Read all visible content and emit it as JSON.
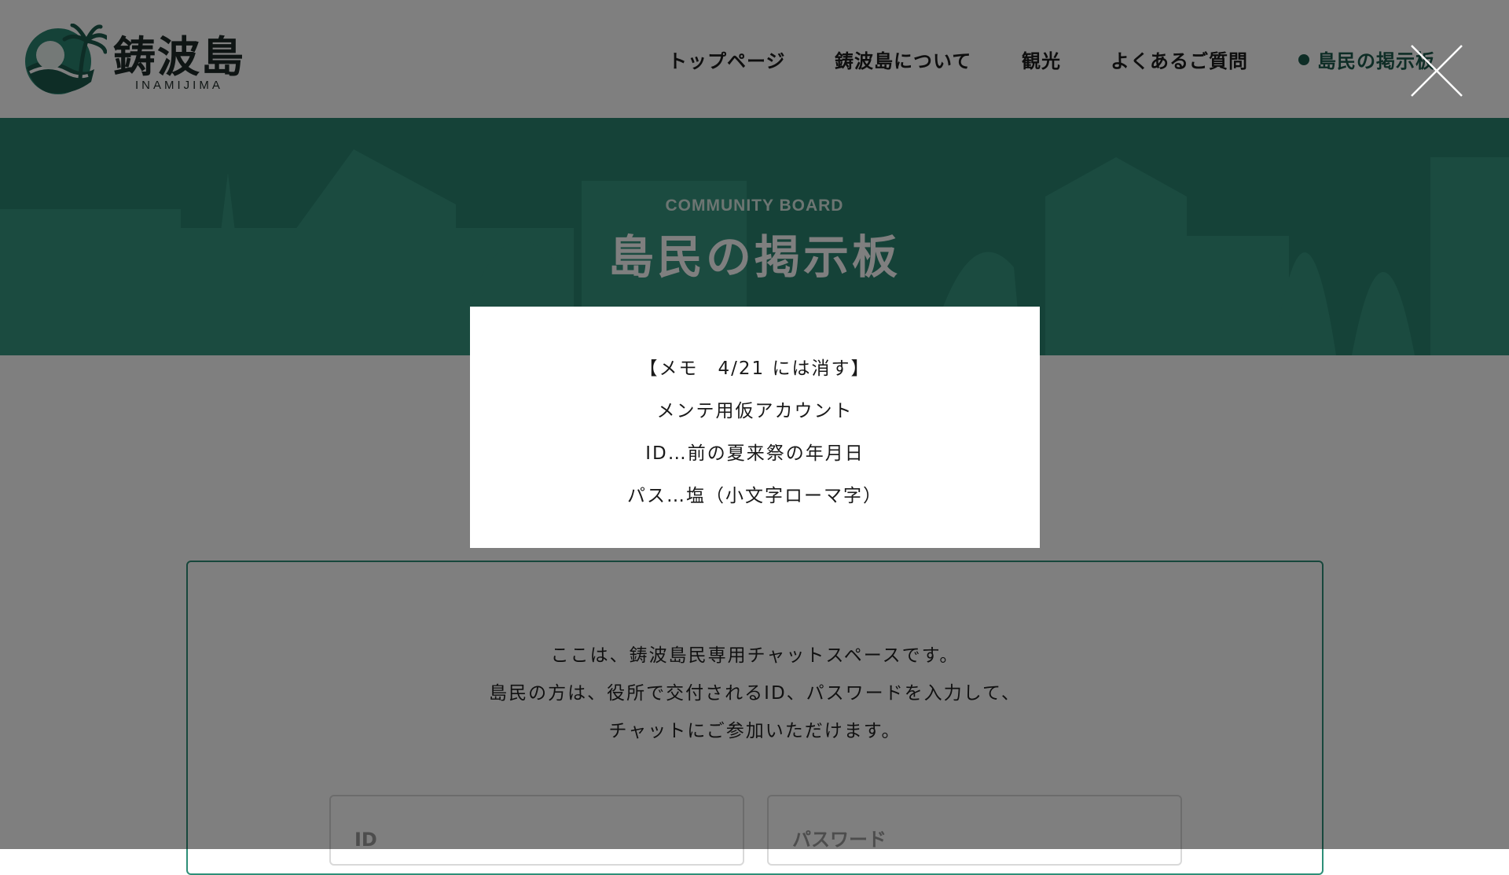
{
  "site": {
    "logo_title": "鋳波島",
    "logo_subtitle": "INAMIJIMA"
  },
  "nav": {
    "items": [
      {
        "label": "トップページ",
        "active": false
      },
      {
        "label": "鋳波島について",
        "active": false
      },
      {
        "label": "観光",
        "active": false
      },
      {
        "label": "よくあるご質問",
        "active": false
      },
      {
        "label": "島民の掲示板",
        "active": true
      }
    ]
  },
  "hero": {
    "subtitle": "COMMUNITY BOARD",
    "title": "島民の掲示板"
  },
  "board": {
    "intro_lines": [
      "ここは、鋳波島民専用チャットスペースです。",
      "島民の方は、役所で交付されるID、パスワードを入力して、",
      "チャットにご参加いただけます。"
    ],
    "id_placeholder": "ID",
    "password_placeholder": "パスワード"
  },
  "modal": {
    "lines": [
      "【メモ　4/21 には消す】",
      "メンテ用仮アカウント",
      "ID…前の夏来祭の年月日",
      "パス…塩（小文字ローマ字）"
    ]
  },
  "icons": {
    "close": "close-icon",
    "logo": "palm-island-logo-icon"
  },
  "colors": {
    "brand_green": "#2a8571",
    "dark_green": "#1c5a4c",
    "overlay": "rgba(0,0,0,0.5)"
  }
}
